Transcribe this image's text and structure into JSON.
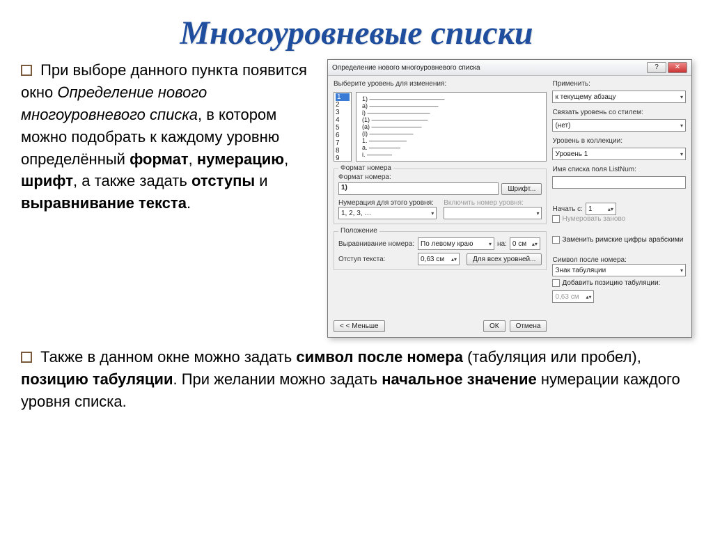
{
  "title": "Многоуровневые списки",
  "paragraph1": {
    "pre": " При выборе данного пункта появится окно ",
    "em": "Определение нового многоуровневого списка",
    "mid": ", в котором можно подобрать к каждому уровню определённый ",
    "b1": "формат",
    "s1": ", ",
    "b2": "нумерацию",
    "s2": ", ",
    "b3": "шрифт",
    "s3": ", а также задать ",
    "b4": "отступы",
    "s4": " и ",
    "b5": "выравнивание текста",
    "end": "."
  },
  "paragraph2": {
    "pre": " Также в данном окне можно задать ",
    "b1": "символ после номера",
    "s1": " (табуляция или пробел), ",
    "b2": "позицию табуляции",
    "s2": ". При желании можно  задать ",
    "b3": "начальное значение",
    "end": " нумерации каждого уровня списка."
  },
  "dialog": {
    "title": "Определение нового многоуровневого списка",
    "help": "?",
    "close": "✕",
    "chooseLevel": "Выберите уровень для изменения:",
    "levels": [
      "1",
      "2",
      "3",
      "4",
      "5",
      "6",
      "7",
      "8",
      "9"
    ],
    "preview": [
      "1) ————————————",
      "  a) ———————————",
      "    i) ——————————",
      "      (1) —————————",
      "        (a) ————————",
      "          (i) ———————",
      "            1. ——————",
      "              a. —————",
      "                i. ————"
    ],
    "apply": "Применить:",
    "applyVal": "к текущему абзацу",
    "linkStyle": "Связать уровень со стилем:",
    "linkVal": "(нет)",
    "collLevel": "Уровень в коллекции:",
    "collVal": "Уровень 1",
    "listNum": "Имя списка поля ListNum:",
    "formatGroup": "Формат номера",
    "formatLabel": "Формат номера:",
    "formatVal": "1)",
    "fontBtn": "Шрифт...",
    "numThis": "Нумерация для этого уровня:",
    "numThisVal": "1, 2, 3, …",
    "includeLvl": "Включить номер уровня:",
    "startAt": "Начать с:",
    "startVal": "1",
    "restart": "Нумеровать заново",
    "roman": "Заменить римские цифры арабскими",
    "posGroup": "Положение",
    "alignLbl": "Выравнивание номера:",
    "alignVal": "По левому краю",
    "atLbl": "на:",
    "atVal": "0 см",
    "indentLbl": "Отступ текста:",
    "indentVal": "0,63 см",
    "allLevels": "Для всех уровней...",
    "symAfter": "Символ после номера:",
    "symAfterVal": "Знак табуляции",
    "addTab": "Добавить позицию табуляции:",
    "tabVal": "0,63 см",
    "less": "< < Меньше",
    "ok": "ОК",
    "cancel": "Отмена"
  }
}
